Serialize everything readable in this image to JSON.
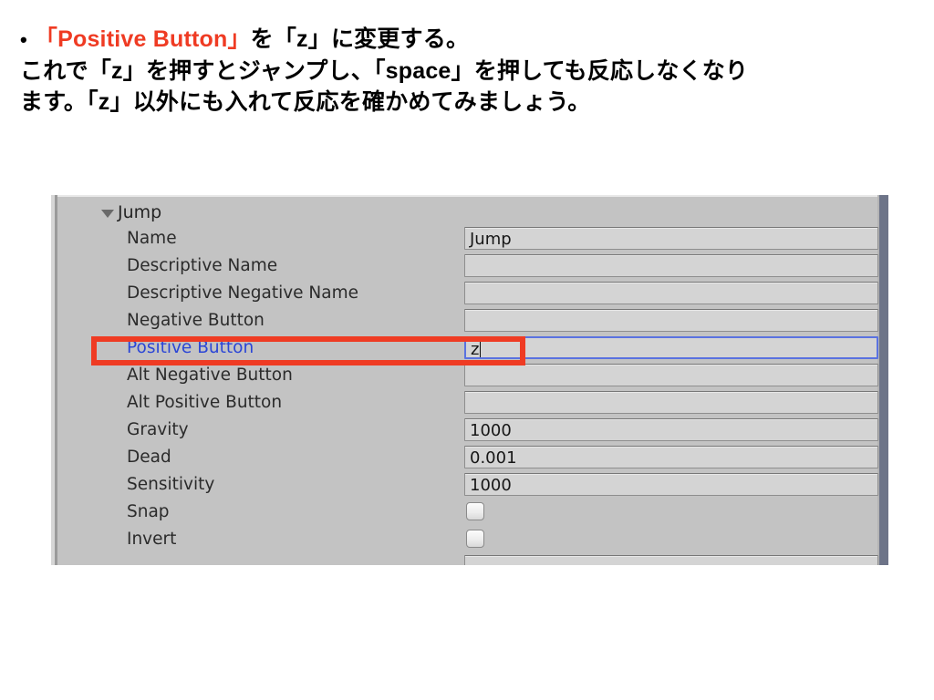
{
  "instructions": {
    "bullet_glyph": "•",
    "line1_red": "「Positive Button」",
    "line1_black": "を「z」に変更する。",
    "line2": "これで「z」を押すとジャンプし、「space」を押しても反応しなくなり",
    "line3": "ます。「z」以外にも入れて反応を確かめてみましょう。"
  },
  "colors": {
    "accent_red": "#ef3b23",
    "highlight_blue": "#2b46d6",
    "focus_border": "#5a72e0",
    "panel_bg": "#c3c3c3",
    "field_bg": "#d4d4d4"
  },
  "inspector": {
    "foldout": {
      "label": "Jump",
      "expanded": true,
      "triangle_glyph": "▼"
    },
    "rows": [
      {
        "label": "Name",
        "type": "text",
        "value": "Jump",
        "focused": false,
        "highlighted": false
      },
      {
        "label": "Descriptive Name",
        "type": "text",
        "value": "",
        "focused": false,
        "highlighted": false
      },
      {
        "label": "Descriptive Negative Name",
        "type": "text",
        "value": "",
        "focused": false,
        "highlighted": false
      },
      {
        "label": "Negative Button",
        "type": "text",
        "value": "",
        "focused": false,
        "highlighted": false
      },
      {
        "label": "Positive Button",
        "type": "text",
        "value": "z",
        "focused": true,
        "highlighted": true
      },
      {
        "label": "Alt Negative Button",
        "type": "text",
        "value": "",
        "focused": false,
        "highlighted": false
      },
      {
        "label": "Alt Positive Button",
        "type": "text",
        "value": "",
        "focused": false,
        "highlighted": false
      },
      {
        "label": "Gravity",
        "type": "text",
        "value": "1000",
        "focused": false,
        "highlighted": false
      },
      {
        "label": "Dead",
        "type": "text",
        "value": "0.001",
        "focused": false,
        "highlighted": false
      },
      {
        "label": "Sensitivity",
        "type": "text",
        "value": "1000",
        "focused": false,
        "highlighted": false
      },
      {
        "label": "Snap",
        "type": "checkbox",
        "value": "",
        "checked": false,
        "highlighted": false
      },
      {
        "label": "Invert",
        "type": "checkbox",
        "value": "",
        "checked": false,
        "highlighted": false
      },
      {
        "label": "",
        "type": "partial",
        "value": "",
        "focused": false,
        "highlighted": false
      }
    ]
  }
}
